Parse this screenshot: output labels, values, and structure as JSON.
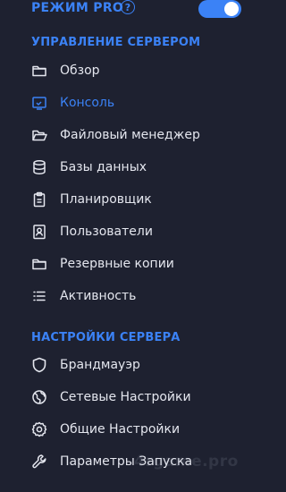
{
  "pro_mode": {
    "label": "Режим PRO",
    "help": "?",
    "enabled": true
  },
  "server_management": {
    "title": "Управление сервером",
    "items": [
      {
        "id": "overview",
        "label": "Обзор",
        "icon": "folder-icon"
      },
      {
        "id": "console",
        "label": "Консоль",
        "icon": "console-icon",
        "active": true
      },
      {
        "id": "file-manager",
        "label": "Файловый менеджер",
        "icon": "folder-open-icon"
      },
      {
        "id": "databases",
        "label": "Базы данных",
        "icon": "database-icon"
      },
      {
        "id": "scheduler",
        "label": "Планировщик",
        "icon": "clipboard-icon"
      },
      {
        "id": "users",
        "label": "Пользователи",
        "icon": "user-card-icon"
      },
      {
        "id": "backups",
        "label": "Резервные копии",
        "icon": "folder-icon"
      },
      {
        "id": "activity",
        "label": "Активность",
        "icon": "list-icon"
      }
    ]
  },
  "server_settings": {
    "title": "Настройки сервера",
    "items": [
      {
        "id": "firewall",
        "label": "Брандмауэр",
        "icon": "shield-icon"
      },
      {
        "id": "network",
        "label": "Сетевые Настройки",
        "icon": "globe-icon"
      },
      {
        "id": "general",
        "label": "Общие Настройки",
        "icon": "gear-icon"
      },
      {
        "id": "startup",
        "label": "Параметры Запуска",
        "icon": "wrench-icon"
      }
    ]
  },
  "watermark": "4rgame.pro",
  "colors": {
    "background": "#1e2130",
    "accent": "#3b82f6",
    "text": "#e4e6ee"
  }
}
